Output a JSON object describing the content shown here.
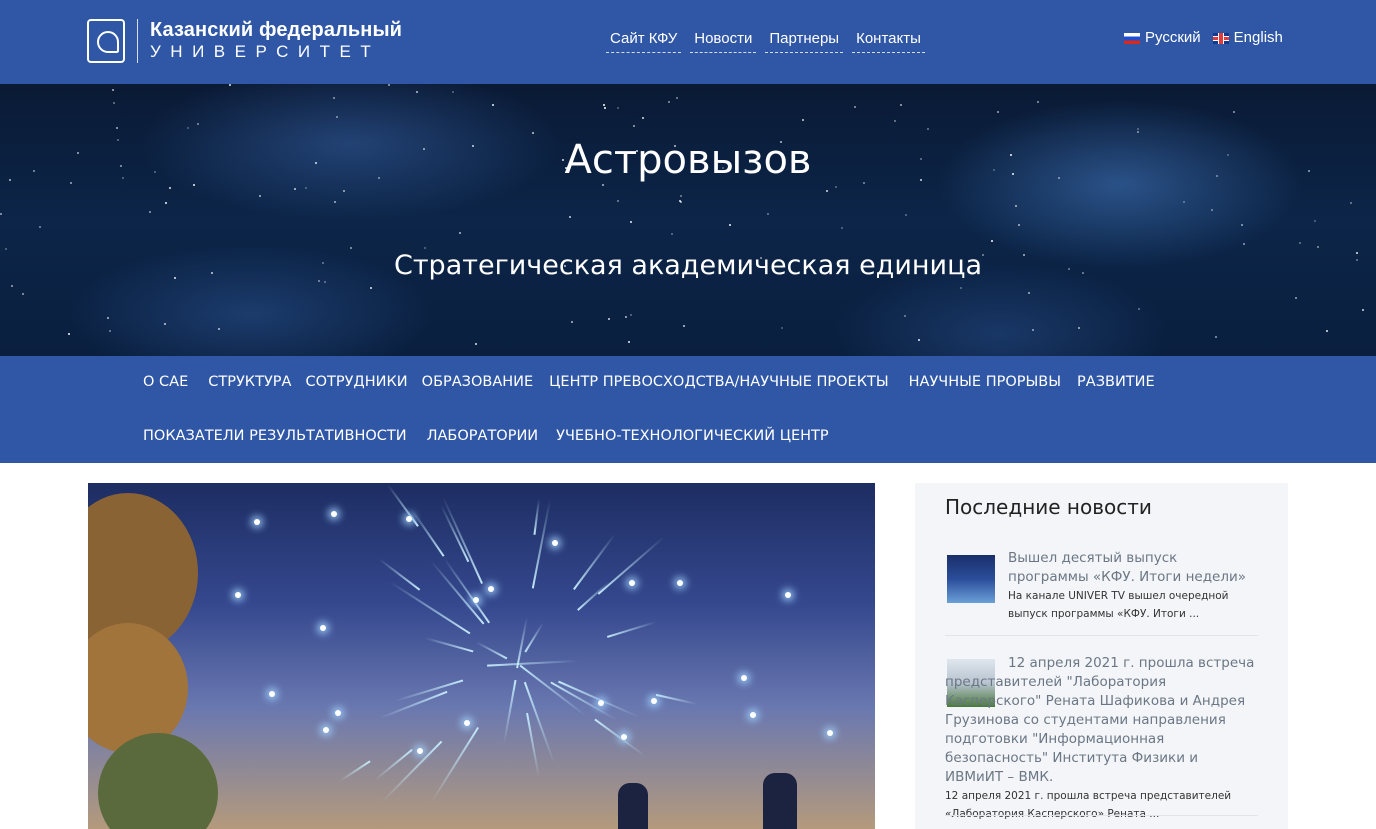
{
  "header": {
    "logo_line1": "Казанский федеральный",
    "logo_line2": "УНИВЕРСИТЕТ",
    "links": [
      "Сайт КФУ",
      "Новости",
      "Партнеры",
      "Контакты"
    ],
    "languages": [
      {
        "label": "Русский",
        "flag": "flag-ru-icon"
      },
      {
        "label": "English",
        "flag": "flag-gb-icon"
      }
    ]
  },
  "hero": {
    "title": "Астровызов",
    "subtitle": "Стратегическая академическая единица"
  },
  "nav": {
    "row1": [
      "О САЕ",
      "СТРУКТУРА",
      "СОТРУДНИКИ",
      "ОБРАЗОВАНИЕ",
      "ЦЕНТР ПРЕВОСХОДСТВА/НАУЧНЫЕ ПРОЕКТЫ",
      "НАУЧНЫЕ ПРОРЫВЫ",
      "РАЗВИТИЕ"
    ],
    "row2": [
      "ПОКАЗАТЕЛИ РЕЗУЛЬТАТИВНОСТИ",
      "ЛАБОРАТОРИИ",
      "УЧЕБНО-ТЕХНОЛОГИЧЕСКИЙ ЦЕНТР"
    ]
  },
  "sidebar": {
    "title": "Последние новости",
    "news": [
      {
        "title": "Вышел десятый выпуск программы «КФУ. Итоги недели»",
        "excerpt": "На канале UNIVER TV вышел очередной выпуск программы «КФУ. Итоги ..."
      },
      {
        "title": "12 апреля 2021 г. прошла встреча представителей \"Лаборатория Касперского\" Рената Шафикова и Андрея Грузинова со студентами направления подготовки \"Информационная безопасность\" Института Физики и ИВМиИТ – ВМК.",
        "excerpt": "12 апреля 2021 г. прошла встреча представителей «Лаборатория Касперского» Рената ..."
      }
    ]
  },
  "colors": {
    "brand_blue": "#2f57a6",
    "sidebar_bg": "#f3f5f8",
    "news_title": "#6b7785"
  }
}
